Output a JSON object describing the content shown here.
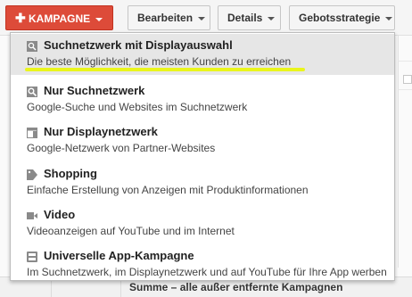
{
  "toolbar": {
    "campaign_label": "KAMPAGNE",
    "edit_label": "Bearbeiten",
    "details_label": "Details",
    "bid_label": "Gebotsstrategie"
  },
  "menu": {
    "items": [
      {
        "title": "Suchnetzwerk mit Displayauswahl",
        "desc": "Die beste Möglichkeit, die meisten Kunden zu erreichen",
        "icon": "search-display-icon"
      },
      {
        "title": "Nur Suchnetzwerk",
        "desc": "Google-Suche und Websites im Suchnetzwerk",
        "icon": "search-icon"
      },
      {
        "title": "Nur Displaynetzwerk",
        "desc": "Google-Netzwerk von Partner-Websites",
        "icon": "display-layout-icon"
      },
      {
        "title": "Shopping",
        "desc": "Einfache Erstellung von Anzeigen mit Produktinformationen",
        "icon": "tag-icon"
      },
      {
        "title": "Video",
        "desc": "Videoanzeigen auf YouTube und im Internet",
        "icon": "video-camera-icon"
      },
      {
        "title": "Universelle App-Kampagne",
        "desc": "Im Suchnetzwerk, im Displaynetzwerk und auf YouTube für Ihre App werben",
        "icon": "app-icon"
      }
    ]
  },
  "footer": {
    "summary": "Summe – alle außer entfernte Kampagnen"
  },
  "colors": {
    "primary_button": "#dd4b39",
    "highlight": "#f5f52a",
    "active_row": "#e6e6e6"
  }
}
